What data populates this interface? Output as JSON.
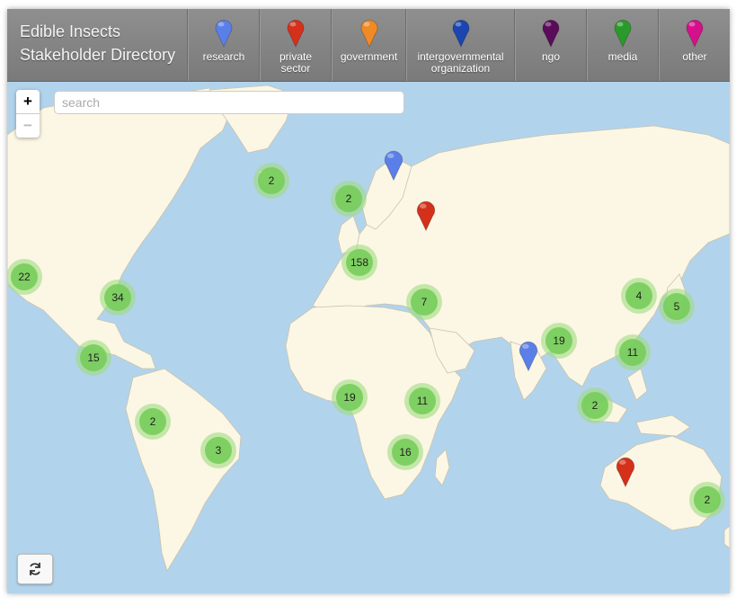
{
  "header": {
    "title_line1": "Edible Insects",
    "title_line2": "Stakeholder Directory"
  },
  "categories": [
    {
      "label": "research",
      "color": "#5b7fe8"
    },
    {
      "label": "private\nsector",
      "color": "#d4301a"
    },
    {
      "label": "government",
      "color": "#f08a24"
    },
    {
      "label": "intergovernmental\norganization",
      "color": "#1c45b0"
    },
    {
      "label": "ngo",
      "color": "#5a0b5a"
    },
    {
      "label": "media",
      "color": "#2a9a2a"
    },
    {
      "label": "other",
      "color": "#d4108a"
    }
  ],
  "controls": {
    "zoom_in": "+",
    "zoom_out": "−",
    "search_placeholder": "search"
  },
  "clusters": [
    {
      "count": "2"
    },
    {
      "count": "2"
    },
    {
      "count": "22"
    },
    {
      "count": "34"
    },
    {
      "count": "158"
    },
    {
      "count": "7"
    },
    {
      "count": "4"
    },
    {
      "count": "5"
    },
    {
      "count": "19"
    },
    {
      "count": "11"
    },
    {
      "count": "15"
    },
    {
      "count": "19"
    },
    {
      "count": "11"
    },
    {
      "count": "2"
    },
    {
      "count": "2"
    },
    {
      "count": "3"
    },
    {
      "count": "16"
    },
    {
      "count": "2"
    }
  ],
  "markers": [
    {
      "category": "research"
    },
    {
      "category": "private sector"
    },
    {
      "category": "research"
    },
    {
      "category": "private sector"
    }
  ]
}
